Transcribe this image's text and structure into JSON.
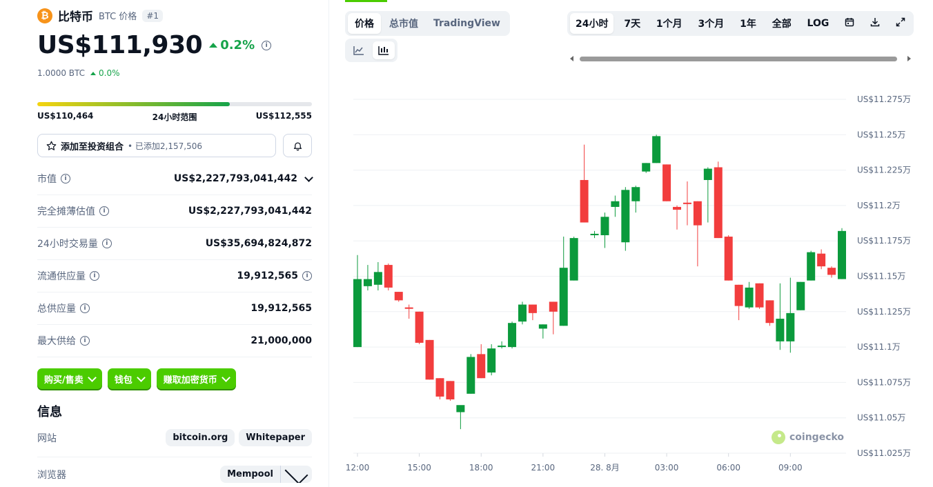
{
  "coin": {
    "name": "比特币",
    "symbol_label": "BTC 价格",
    "rank": "#1",
    "logo_char": "₿",
    "price": "US$111,930",
    "change_24h": "0.2%",
    "btc_amount": "1.0000 BTC",
    "btc_change": "0.0%",
    "colors": {
      "up": "#16a34a",
      "brand": "#f7931a",
      "accent": "#4bcc00"
    }
  },
  "range": {
    "low": "US$110,464",
    "label": "24小时范围",
    "high": "US$112,555",
    "position_fraction": 0.7
  },
  "portfolio": {
    "label": "添加至投资组合",
    "count_text": "• 已添加2,157,506",
    "star_icon": "star-icon",
    "bell_icon": "bell-icon"
  },
  "stats": [
    {
      "label": "市值",
      "value": "US$2,227,793,041,442",
      "has_info": true,
      "has_dropdown": true,
      "value_info": false
    },
    {
      "label": "完全摊薄估值",
      "value": "US$2,227,793,041,442",
      "has_info": true,
      "has_dropdown": false,
      "value_info": false
    },
    {
      "label": "24小时交易量",
      "value": "US$35,694,824,872",
      "has_info": true,
      "has_dropdown": false,
      "value_info": false
    },
    {
      "label": "流通供应量",
      "value": "19,912,565",
      "has_info": true,
      "has_dropdown": false,
      "value_info": true
    },
    {
      "label": "总供应量",
      "value": "19,912,565",
      "has_info": true,
      "has_dropdown": false,
      "value_info": false
    },
    {
      "label": "最大供给",
      "value": "21,000,000",
      "has_info": true,
      "has_dropdown": false,
      "value_info": false
    }
  ],
  "actions": {
    "buy_sell": "购买/售卖",
    "wallet": "钱包",
    "earn": "赚取加密货币"
  },
  "info": {
    "title": "信息",
    "website_label": "网站",
    "website_links": [
      "bitcoin.org",
      "Whitepaper"
    ],
    "explorer_label": "浏览器",
    "explorer_value": "Mempool"
  },
  "chart_tabs": {
    "metric": [
      "价格",
      "总市值",
      "TradingView"
    ],
    "active_metric": 0,
    "chart_type_icons": [
      "line-chart-icon",
      "candlestick-icon"
    ],
    "active_chart_type": 1,
    "ranges": [
      "24小时",
      "7天",
      "1个月",
      "3个月",
      "1年",
      "全部",
      "LOG"
    ],
    "active_range": 0,
    "tool_icons": [
      "calendar-icon",
      "download-icon",
      "expand-icon"
    ]
  },
  "watermark": "coingecko",
  "chart_data": {
    "type": "candlestick",
    "y_ticks": [
      "US$11.275万",
      "US$11.25万",
      "US$11.225万",
      "US$11.2万",
      "US$11.175万",
      "US$11.15万",
      "US$11.125万",
      "US$11.1万",
      "US$11.075万",
      "US$11.05万",
      "US$11.025万"
    ],
    "y_tick_values": [
      112750,
      112500,
      112250,
      112000,
      111750,
      111500,
      111250,
      111000,
      110750,
      110500,
      110250
    ],
    "ylim": [
      110250,
      112750
    ],
    "x_ticks": [
      "12:00",
      "15:00",
      "18:00",
      "21:00",
      "28. 8月",
      "03:00",
      "06:00",
      "09:00"
    ],
    "x_tick_hours": [
      12,
      15,
      18,
      21,
      24,
      27,
      30,
      33
    ],
    "xlim_hours": [
      12,
      35.5
    ],
    "candles": [
      {
        "t": 12.0,
        "o": 111000,
        "h": 111650,
        "l": 111000,
        "c": 111480
      },
      {
        "t": 12.5,
        "o": 111430,
        "h": 111580,
        "l": 111400,
        "c": 111480
      },
      {
        "t": 13.0,
        "o": 111440,
        "h": 111600,
        "l": 111400,
        "c": 111530
      },
      {
        "t": 13.5,
        "o": 111580,
        "h": 111590,
        "l": 111400,
        "c": 111420
      },
      {
        "t": 14.0,
        "o": 111390,
        "h": 111390,
        "l": 111320,
        "c": 111330
      },
      {
        "t": 14.5,
        "o": 111280,
        "h": 111300,
        "l": 111200,
        "c": 111270
      },
      {
        "t": 15.0,
        "o": 111250,
        "h": 111250,
        "l": 111020,
        "c": 111030
      },
      {
        "t": 15.5,
        "o": 111050,
        "h": 111050,
        "l": 110770,
        "c": 110770
      },
      {
        "t": 16.0,
        "o": 110780,
        "h": 110780,
        "l": 110630,
        "c": 110650
      },
      {
        "t": 16.5,
        "o": 110760,
        "h": 110760,
        "l": 110620,
        "c": 110630
      },
      {
        "t": 17.0,
        "o": 110540,
        "h": 110580,
        "l": 110420,
        "c": 110590
      },
      {
        "t": 17.5,
        "o": 110670,
        "h": 110950,
        "l": 110670,
        "c": 110930
      },
      {
        "t": 18.0,
        "o": 110950,
        "h": 111020,
        "l": 110780,
        "c": 110780
      },
      {
        "t": 18.5,
        "o": 110820,
        "h": 111020,
        "l": 110800,
        "c": 110990
      },
      {
        "t": 19.0,
        "o": 111000,
        "h": 111040,
        "l": 110990,
        "c": 111010
      },
      {
        "t": 19.5,
        "o": 111000,
        "h": 111180,
        "l": 110990,
        "c": 111170
      },
      {
        "t": 20.0,
        "o": 111180,
        "h": 111320,
        "l": 111160,
        "c": 111300
      },
      {
        "t": 20.5,
        "o": 111300,
        "h": 111300,
        "l": 111190,
        "c": 111240
      },
      {
        "t": 21.0,
        "o": 111130,
        "h": 111160,
        "l": 111060,
        "c": 111160
      },
      {
        "t": 21.5,
        "o": 111320,
        "h": 111320,
        "l": 111090,
        "c": 111250
      },
      {
        "t": 22.0,
        "o": 111150,
        "h": 111780,
        "l": 111150,
        "c": 111560
      },
      {
        "t": 22.5,
        "o": 111470,
        "h": 111780,
        "l": 111470,
        "c": 111770
      },
      {
        "t": 23.0,
        "o": 112180,
        "h": 112430,
        "l": 111880,
        "c": 111880
      },
      {
        "t": 23.5,
        "o": 111790,
        "h": 111820,
        "l": 111770,
        "c": 111800
      },
      {
        "t": 24.0,
        "o": 111790,
        "h": 111950,
        "l": 111700,
        "c": 111920
      },
      {
        "t": 24.5,
        "o": 111990,
        "h": 112070,
        "l": 111920,
        "c": 112030
      },
      {
        "t": 25.0,
        "o": 111740,
        "h": 112130,
        "l": 111680,
        "c": 112110
      },
      {
        "t": 25.5,
        "o": 112030,
        "h": 112140,
        "l": 111950,
        "c": 112130
      },
      {
        "t": 26.0,
        "o": 112240,
        "h": 112300,
        "l": 112230,
        "c": 112300
      },
      {
        "t": 26.5,
        "o": 112300,
        "h": 112500,
        "l": 112300,
        "c": 112490
      },
      {
        "t": 27.0,
        "o": 112290,
        "h": 112290,
        "l": 112030,
        "c": 112030
      },
      {
        "t": 27.5,
        "o": 111990,
        "h": 112000,
        "l": 111830,
        "c": 111970
      },
      {
        "t": 28.0,
        "o": 112020,
        "h": 112170,
        "l": 111860,
        "c": 112010
      },
      {
        "t": 28.5,
        "o": 112030,
        "h": 112030,
        "l": 111570,
        "c": 111860
      },
      {
        "t": 29.0,
        "o": 112180,
        "h": 112270,
        "l": 111880,
        "c": 112260
      },
      {
        "t": 29.5,
        "o": 112270,
        "h": 112310,
        "l": 111770,
        "c": 111770
      },
      {
        "t": 30.0,
        "o": 111780,
        "h": 111790,
        "l": 111470,
        "c": 111470
      },
      {
        "t": 30.5,
        "o": 111440,
        "h": 111440,
        "l": 111190,
        "c": 111290
      },
      {
        "t": 31.0,
        "o": 111280,
        "h": 111460,
        "l": 111270,
        "c": 111420
      },
      {
        "t": 31.5,
        "o": 111450,
        "h": 111450,
        "l": 111270,
        "c": 111280
      },
      {
        "t": 32.0,
        "o": 111330,
        "h": 111330,
        "l": 111150,
        "c": 111170
      },
      {
        "t": 32.5,
        "o": 111040,
        "h": 111450,
        "l": 110980,
        "c": 111200
      },
      {
        "t": 33.0,
        "o": 111040,
        "h": 111490,
        "l": 110960,
        "c": 111240
      },
      {
        "t": 33.5,
        "o": 111260,
        "h": 111460,
        "l": 111260,
        "c": 111460
      },
      {
        "t": 34.0,
        "o": 111470,
        "h": 111680,
        "l": 111470,
        "c": 111670
      },
      {
        "t": 34.5,
        "o": 111660,
        "h": 111690,
        "l": 111550,
        "c": 111570
      },
      {
        "t": 35.0,
        "o": 111560,
        "h": 111570,
        "l": 111490,
        "c": 111510
      },
      {
        "t": 35.5,
        "o": 111480,
        "h": 111840,
        "l": 111480,
        "c": 111820
      }
    ],
    "up_color": "#0b9a3c",
    "down_color": "#f23d3d",
    "grid": true
  }
}
